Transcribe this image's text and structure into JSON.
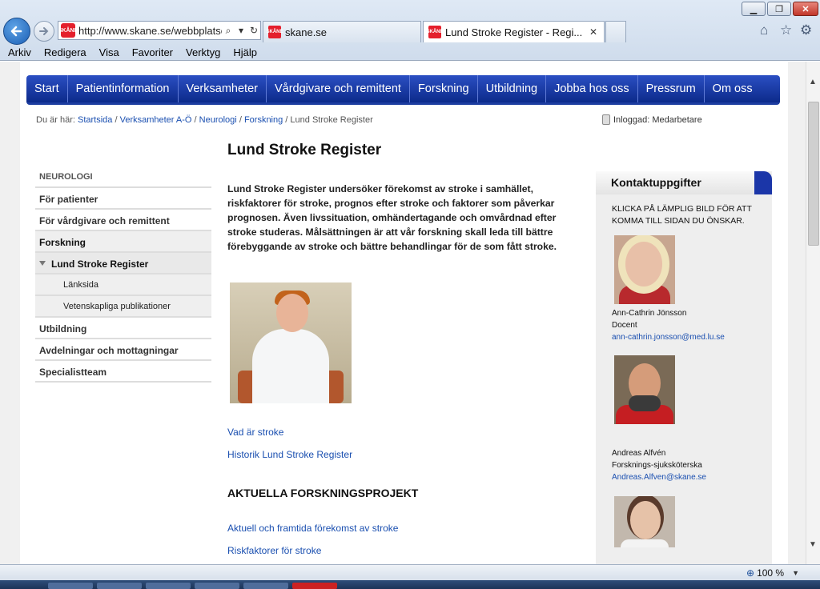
{
  "browser": {
    "address": "http://www.skane.se/webbplatse",
    "tabs": [
      {
        "label": "skane.se"
      },
      {
        "label": "Lund Stroke Register - Regi..."
      }
    ],
    "site_logo": "SKÅNE",
    "menu": [
      "Arkiv",
      "Redigera",
      "Visa",
      "Favoriter",
      "Verktyg",
      "Hjälp"
    ],
    "zoom": "100 %"
  },
  "topnav": [
    "Start",
    "Patientinformation",
    "Verksamheter",
    "Vårdgivare och remittent",
    "Forskning",
    "Utbildning",
    "Jobba hos oss",
    "Pressrum",
    "Om oss"
  ],
  "breadcrumb": {
    "prefix": "Du är här:",
    "items": [
      "Startsida",
      "Verksamheter A-Ö",
      "Neurologi",
      "Forskning"
    ],
    "separator": "/",
    "current": "Lund Stroke Register"
  },
  "login": "Inloggad: Medarbetare",
  "page_title": "Lund Stroke Register",
  "leftnav": {
    "heading": "NEUROLOGI",
    "items": [
      "För patienter",
      "För vårdgivare och remittent",
      "Forskning",
      "Lund Stroke Register",
      "Länksida",
      "Vetenskapliga publikationer",
      "Utbildning",
      "Avdelningar och mottagningar",
      "Specialistteam"
    ]
  },
  "intro": "Lund Stroke Register undersöker förekomst av stroke i samhället, riskfaktorer för stroke, prognos efter stroke och faktorer som påverkar prognosen. Även livssituation, omhändertagande och omvårdnad efter stroke studeras. Målsättningen är att vår forskning skall leda till bättre förebyggande av stroke och bättre behandlingar för de som fått stroke.",
  "links": {
    "what_is_stroke": "Vad är stroke",
    "history": "Historik Lund Stroke Register",
    "projects_heading": "AKTUELLA FORSKNINGSPROJEKT",
    "incidence": "Aktuell och framtida förekomst av stroke",
    "risk": "Riskfaktorer för stroke"
  },
  "contact": {
    "heading": "Kontaktuppgifter",
    "cta": "KLICKA PÅ LÄMPLIG BILD FÖR ATT KOMMA TILL SIDAN DU ÖNSKAR.",
    "people": [
      {
        "name": "Ann-Cathrin Jönsson",
        "role": "Docent",
        "email": "ann-cathrin.jonsson@med.lu.se"
      },
      {
        "name": "Andreas Alfvén",
        "role": "Forsknings-sjuksköterska",
        "email": "Andreas.Alfven@skane.se"
      }
    ]
  },
  "colors": {
    "nav": "#0c2a8a",
    "link": "#1a4fb0",
    "close": "#c1372a"
  }
}
